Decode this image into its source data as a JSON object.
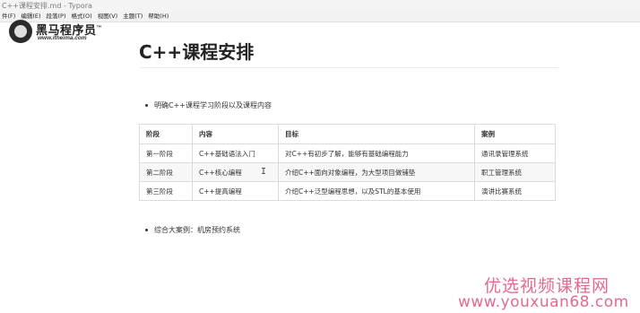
{
  "window": {
    "title": "C++课程安排.md - Typora"
  },
  "menu": [
    "件(F)",
    "编辑(E)",
    "段落(P)",
    "格式(O)",
    "视图(V)",
    "主题(T)",
    "帮助(H)"
  ],
  "logo": {
    "brand": "黑马程序员",
    "tm": "™",
    "url": "www.itheima.com"
  },
  "doc": {
    "title": "C++课程安排",
    "intro_bullet": "明确C++课程学习阶段以及课程内容",
    "table": {
      "headers": [
        "阶段",
        "内容",
        "目标",
        "案例"
      ],
      "rows": [
        [
          "第一阶段",
          "C++基础语法入门",
          "对C++有初步了解，能够有基础编程能力",
          "通讯录管理系统"
        ],
        [
          "第二阶段",
          "C++核心编程",
          "介绍C++面向对象编程，为大型项目做铺垫",
          "职工管理系统"
        ],
        [
          "第三阶段",
          "C++提高编程",
          "介绍C++泛型编程思想，以及STL的基本使用",
          "演讲比赛系统"
        ]
      ]
    },
    "final_bullet": "综合大案例：机房预约系统"
  },
  "cursor_glyph": "I",
  "watermark": {
    "cn": "优选视频课程网",
    "url": "www.youxuan68.com"
  }
}
